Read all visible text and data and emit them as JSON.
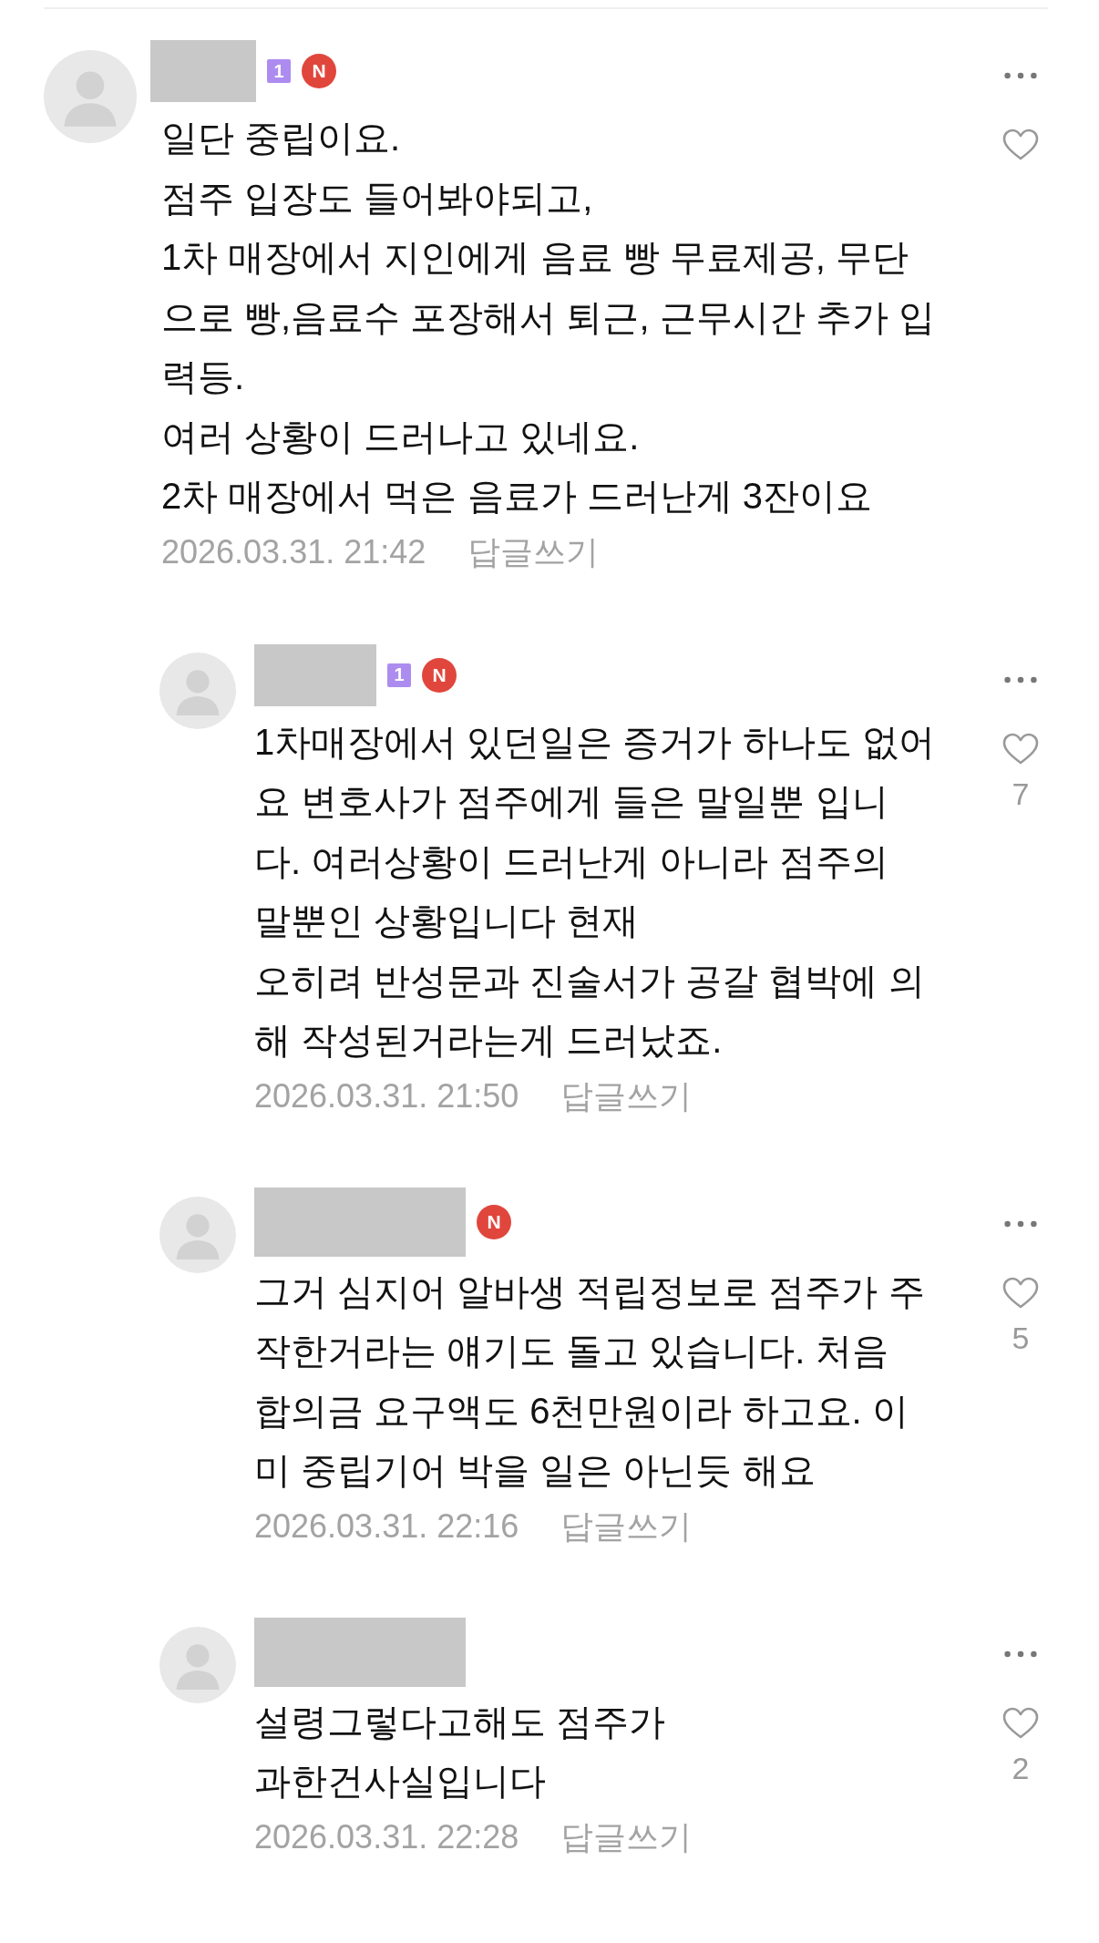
{
  "comments": [
    {
      "kind": "comment",
      "badges": [
        {
          "kind": "level",
          "text": "1"
        },
        {
          "kind": "new",
          "text": "N"
        }
      ],
      "lines": [
        "일단 중립이요.",
        "점주 입장도 들어봐야되고,",
        "1차 매장에서 지인에게 음료 빵 무료제공, 무단",
        "으로 빵,음료수 포장해서 퇴근, 근무시간 추가 입",
        "력등.",
        "여러 상황이 드러나고 있네요.",
        "2차 매장에서 먹은 음료가 드러난게 3잔이요"
      ],
      "date": "2026.03.31. 21:42",
      "reply_label": "답글쓰기"
    },
    {
      "kind": "reply",
      "badges": [
        {
          "kind": "level",
          "text": "1"
        },
        {
          "kind": "new",
          "text": "N"
        }
      ],
      "lines": [
        "1차매장에서 있던일은 증거가 하나도 없어",
        "요 변호사가 점주에게 들은 말일뿐 입니",
        "다. 여러상황이 드러난게 아니라 점주의",
        "말뿐인 상황입니다 현재",
        "오히려 반성문과 진술서가 공갈 협박에 의",
        "해 작성된거라는게 드러났죠."
      ],
      "date": "2026.03.31. 21:50",
      "reply_label": "답글쓰기",
      "likes": "7"
    },
    {
      "kind": "reply",
      "badges": [
        {
          "kind": "new",
          "text": "N"
        }
      ],
      "lines": [
        "그거 심지어 알바생 적립정보로 점주가 주",
        "작한거라는 얘기도 돌고 있습니다. 처음",
        "합의금 요구액도 6천만원이라 하고요. 이",
        "미 중립기어 박을 일은 아닌듯 해요"
      ],
      "date": "2026.03.31. 22:16",
      "reply_label": "답글쓰기",
      "likes": "5"
    },
    {
      "kind": "reply",
      "lines": [
        "설령그렇다고해도 점주가",
        "과한건사실입니다"
      ],
      "date": "2026.03.31. 22:28",
      "reply_label": "답글쓰기",
      "likes": "2"
    }
  ]
}
